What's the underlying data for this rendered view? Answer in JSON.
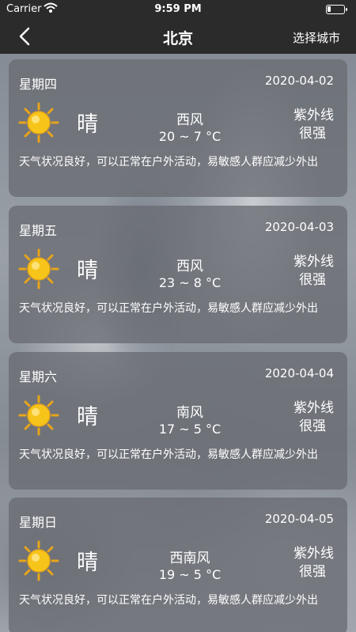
{
  "status": {
    "carrier": "Carrier",
    "time": "9:59 PM"
  },
  "nav": {
    "title": "北京",
    "action": "选择城市"
  },
  "forecast": [
    {
      "weekday": "星期四",
      "date": "2020-04-02",
      "condition": "晴",
      "wind": "西风",
      "temp": "20 ~ 7 °C",
      "uv_label": "紫外线",
      "uv_level": "很强",
      "advice": "天气状况良好，可以正常在户外活动，易敏感人群应减少外出"
    },
    {
      "weekday": "星期五",
      "date": "2020-04-03",
      "condition": "晴",
      "wind": "西风",
      "temp": "23 ~ 8 °C",
      "uv_label": "紫外线",
      "uv_level": "很强",
      "advice": "天气状况良好，可以正常在户外活动，易敏感人群应减少外出"
    },
    {
      "weekday": "星期六",
      "date": "2020-04-04",
      "condition": "晴",
      "wind": "南风",
      "temp": "17 ~ 5 °C",
      "uv_label": "紫外线",
      "uv_level": "很强",
      "advice": "天气状况良好，可以正常在户外活动，易敏感人群应减少外出"
    },
    {
      "weekday": "星期日",
      "date": "2020-04-05",
      "condition": "晴",
      "wind": "西南风",
      "temp": "19 ~ 5 °C",
      "uv_label": "紫外线",
      "uv_level": "很强",
      "advice": "天气状况良好，可以正常在户外活动，易敏感人群应减少外出"
    }
  ],
  "icons": {
    "weather": "sun-icon",
    "back": "chevron-left-icon",
    "wifi": "wifi-icon",
    "battery": "battery-icon"
  }
}
